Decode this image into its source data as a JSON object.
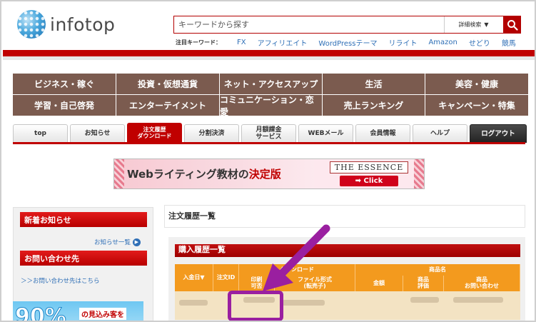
{
  "header": {
    "logo_text": "infotop",
    "search": {
      "placeholder": "キーワードから探す",
      "category_label": "詳細検索"
    },
    "hot_keywords_label": "注目キーワード：",
    "hot_keywords": [
      "FX",
      "アフィリエイト",
      "WordPressテーマ",
      "リライト",
      "Amazon",
      "せどり",
      "競馬"
    ]
  },
  "categories": [
    "ビジネス・稼ぐ",
    "投資・仮想通貨",
    "ネット・アクセスアップ",
    "生活",
    "美容・健康",
    "学習・自己啓発",
    "エンターテイメント",
    "コミュニケーション・恋愛",
    "売上ランキング",
    "キャンペーン・特集"
  ],
  "tabs": [
    {
      "label": "top"
    },
    {
      "label": "お知らせ"
    },
    {
      "label": "注文履歴\nダウンロード"
    },
    {
      "label": "分割決済"
    },
    {
      "label": "月額課金\nサービス"
    },
    {
      "label": "WEBメール"
    },
    {
      "label": "会員情報"
    },
    {
      "label": "ヘルプ"
    },
    {
      "label": "ログアウト"
    }
  ],
  "banner": {
    "text_prefix": "Webライティング教材の",
    "text_highlight": "決定版",
    "product": "THE ESSENCE",
    "click_label": "➡ Click"
  },
  "sidebar": {
    "news_title": "新着お知らせ",
    "news_link": "お知らせ一覧",
    "contact_title": "お問い合わせ先",
    "contact_link": "＞＞お問い合わせ先はこちら",
    "promo_big": "90%",
    "promo_text": "の見込み客を"
  },
  "main": {
    "title": "注文履歴一覧",
    "panel_title": "購入履歴一覧",
    "table": {
      "col_date": "入金日▼",
      "col_order_id": "注文ID",
      "group_download": "ダウンロード",
      "col_print": "印刷\n可否",
      "col_format": "ファイル形式\n(転売子)",
      "group_product": "商品名",
      "col_price": "金額",
      "col_rating": "商品\n評価",
      "col_inquiry": "商品\nお問い合わせ"
    }
  },
  "colors": {
    "brand_red": "#c00000",
    "category_brown": "#7b5b4f",
    "table_orange": "#f39a1e",
    "annotation_purple": "#9a1fa0",
    "link_blue": "#2f6fb6"
  }
}
